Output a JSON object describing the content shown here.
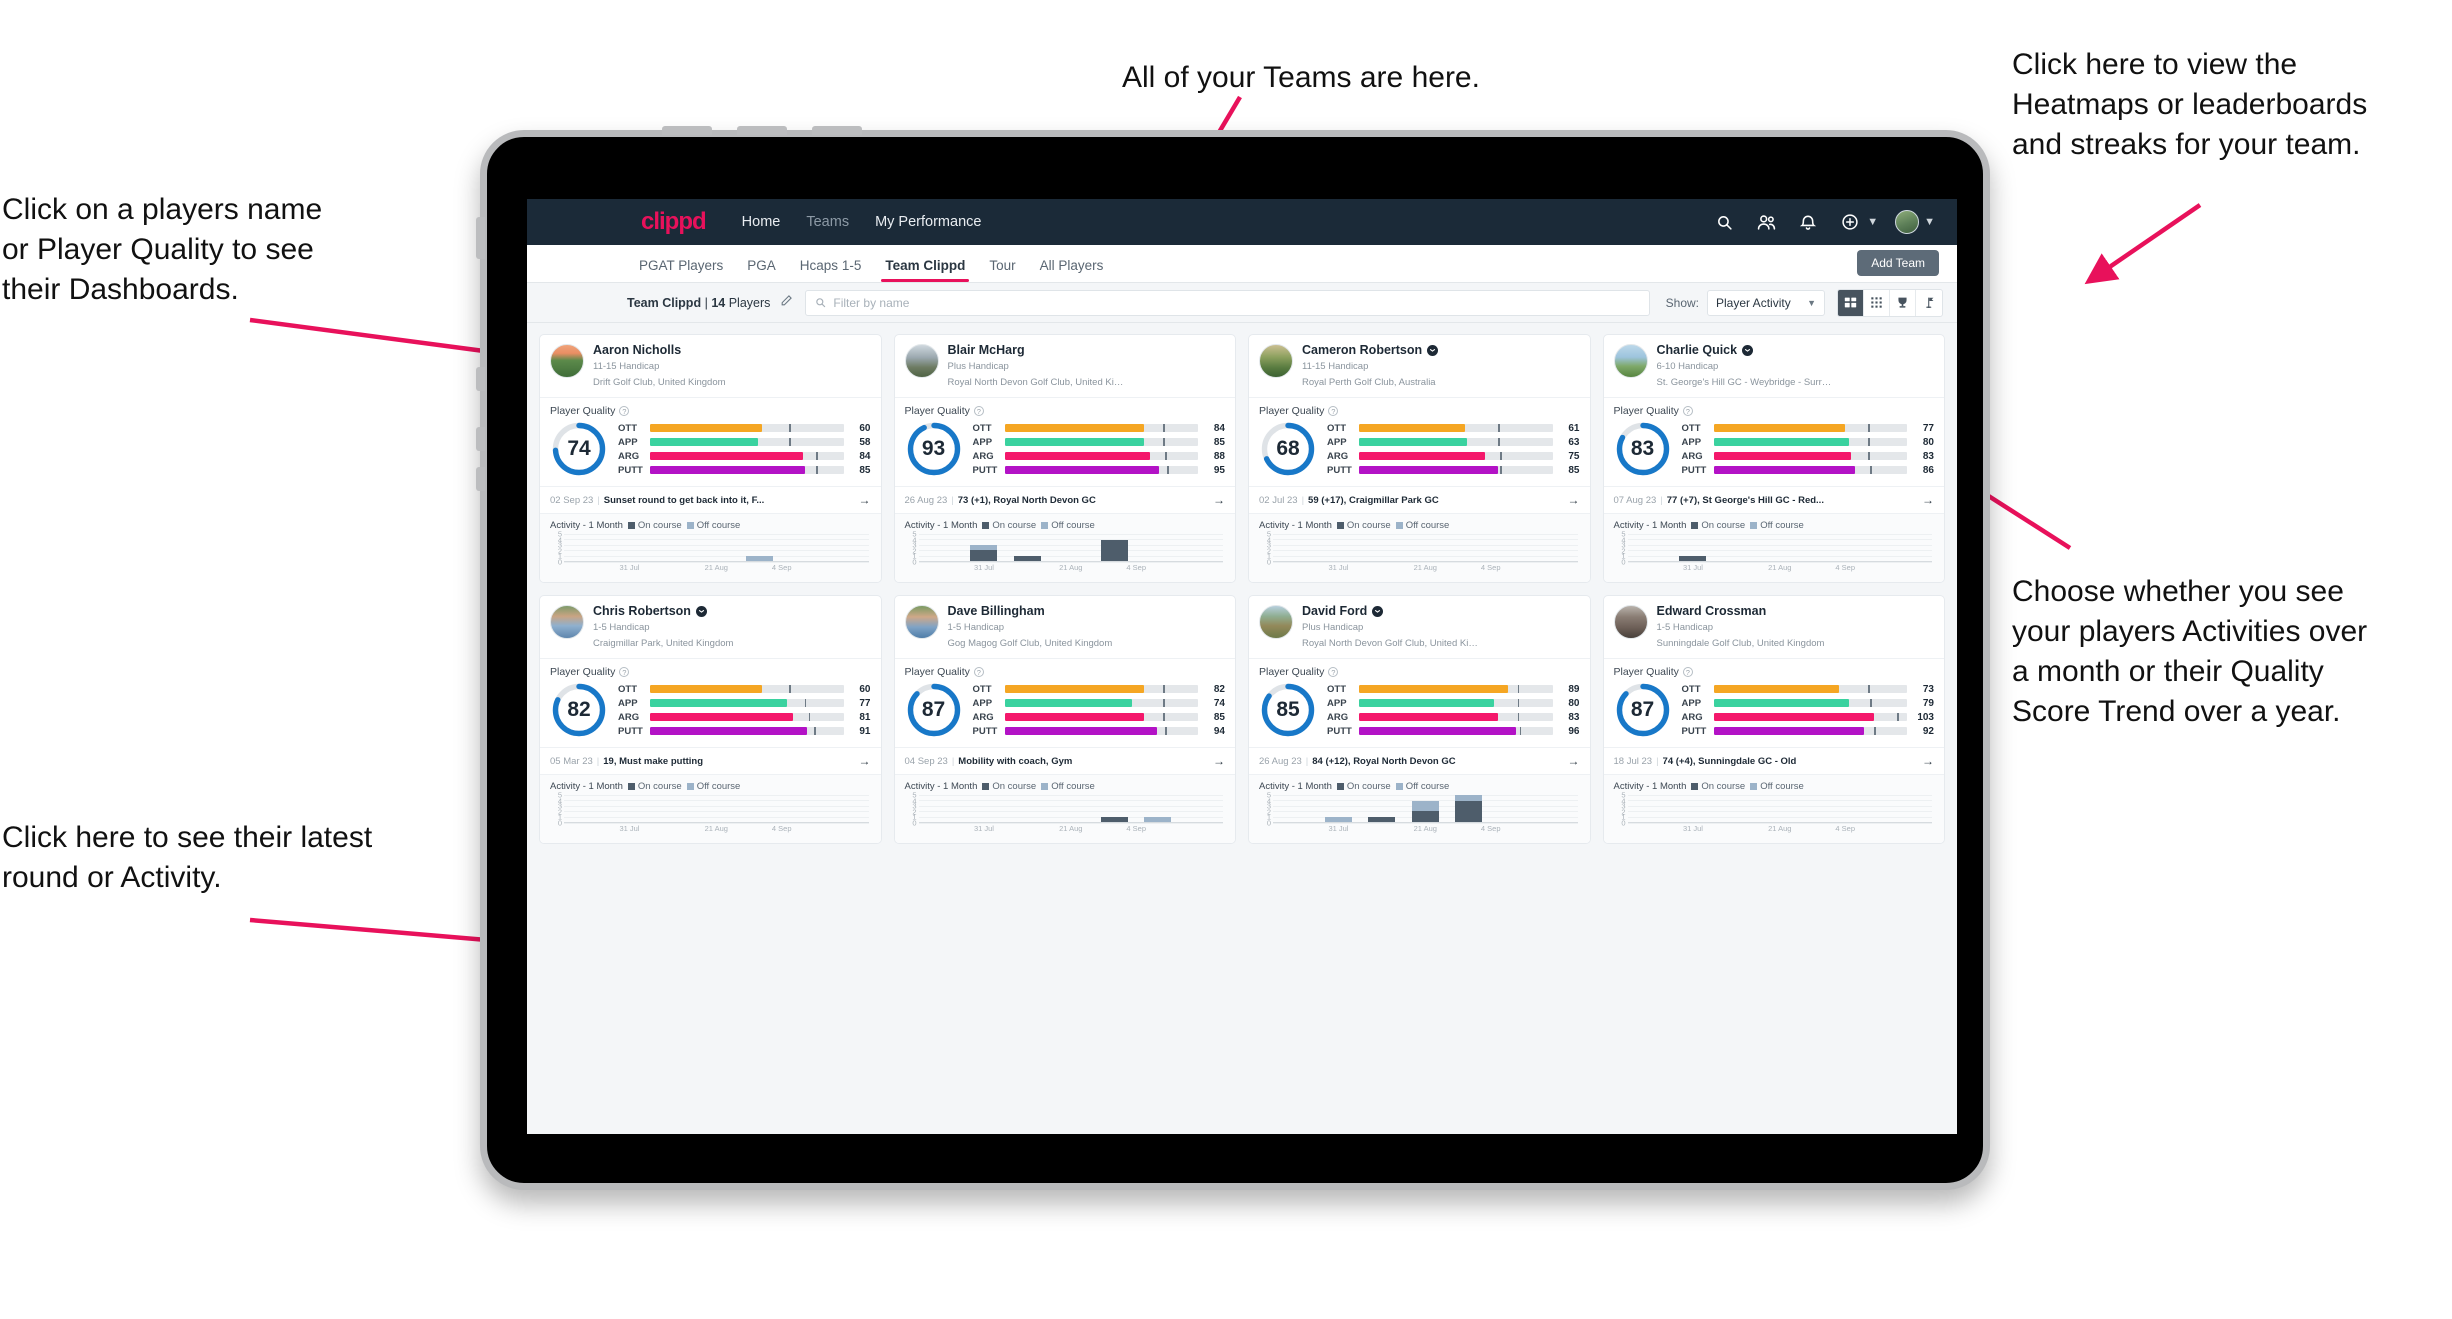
{
  "annotations": {
    "teams": "All of your Teams are here.",
    "heatmaps": "Click here to view the\nHeatmaps or leaderboards\nand streaks for your team.",
    "players": "Click on a players name\nor Player Quality to see\ntheir Dashboards.",
    "choose": "Choose whether you see\nyour players Activities over\na month or their Quality\nScore Trend over a year.",
    "latest": "Click here to see their latest\nround or Activity.",
    "arrow_color": "#e8115b"
  },
  "app": {
    "brand": "clippd",
    "nav_links": [
      {
        "label": "Home",
        "active": true
      },
      {
        "label": "Teams",
        "active": false
      },
      {
        "label": "My Performance",
        "active": true
      }
    ],
    "nav_icons": [
      "search-icon",
      "people-icon",
      "bell-icon",
      "plus-circle-icon",
      "avatar"
    ],
    "tabs": [
      {
        "label": "PGAT Players",
        "active": false
      },
      {
        "label": "PGA",
        "active": false
      },
      {
        "label": "Hcaps 1-5",
        "active": false
      },
      {
        "label": "Team Clippd",
        "active": true
      },
      {
        "label": "Tour",
        "active": false
      },
      {
        "label": "All Players",
        "active": false
      }
    ],
    "add_team_label": "Add Team",
    "filter": {
      "team_name": "Team Clippd",
      "divider": "|",
      "player_count": "14",
      "players_word": "Players",
      "edit_icon": "pencil-icon",
      "search_placeholder": "Filter by name",
      "show_label": "Show:",
      "show_value": "Player Activity",
      "view_buttons": [
        {
          "name": "cards-view",
          "icon": "grid-cards-icon",
          "active": true
        },
        {
          "name": "compact-view",
          "icon": "grid-dots-icon",
          "active": false
        },
        {
          "name": "leaderboard-view",
          "icon": "trophy-icon",
          "active": false
        },
        {
          "name": "heatmap-view",
          "icon": "golf-flag-icon",
          "active": false
        }
      ]
    },
    "card_labels": {
      "quality_title": "Player Quality",
      "help_glyph": "?",
      "activity_title": "Activity - 1 Month",
      "legend_on": "On course",
      "legend_off": "Off course",
      "arrow_glyph": "→"
    },
    "metric_colors": {
      "OTT": "#f5a623",
      "APP": "#3ad29f",
      "ARG": "#f4186b",
      "PUTT": "#b312c6",
      "ring": "#1878c8",
      "ring_track": "#dfe3e7"
    },
    "chart_axis": {
      "y_ticks": [
        "5",
        "4",
        "3",
        "2",
        "1",
        "0"
      ],
      "y_max": 5,
      "x_ticks": [
        "31 Jul",
        "21 Aug",
        "4 Sep"
      ],
      "slots": 7
    }
  },
  "players": [
    {
      "name": "Aaron Nicholls",
      "verified": false,
      "handicap": "11-15 Handicap",
      "club": "Drift Golf Club, United Kingdom",
      "quality": "74",
      "metrics": [
        {
          "label": "OTT",
          "value": "60",
          "fill": 58,
          "tick": 72
        },
        {
          "label": "APP",
          "value": "58",
          "fill": 56,
          "tick": 72
        },
        {
          "label": "ARG",
          "value": "84",
          "fill": 79,
          "tick": 86
        },
        {
          "label": "PUTT",
          "value": "85",
          "fill": 80,
          "tick": 86
        }
      ],
      "round_date": "02 Sep 23",
      "round_text": "Sunset round to get back into it, F...",
      "activity": [
        {
          "on": 0,
          "off": 0
        },
        {
          "on": 0,
          "off": 0
        },
        {
          "on": 0,
          "off": 0
        },
        {
          "on": 0,
          "off": 0
        },
        {
          "on": 0,
          "off": 1
        },
        {
          "on": 0,
          "off": 0
        },
        {
          "on": 0,
          "off": 0
        }
      ],
      "avatar_style": "photo-sunset-fairway"
    },
    {
      "name": "Blair McHarg",
      "verified": false,
      "handicap": "Plus Handicap",
      "club": "Royal North Devon Golf Club, United Kin...",
      "quality": "93",
      "metrics": [
        {
          "label": "OTT",
          "value": "84",
          "fill": 72,
          "tick": 82
        },
        {
          "label": "APP",
          "value": "85",
          "fill": 72,
          "tick": 82
        },
        {
          "label": "ARG",
          "value": "88",
          "fill": 75,
          "tick": 83
        },
        {
          "label": "PUTT",
          "value": "95",
          "fill": 80,
          "tick": 84
        }
      ],
      "round_date": "26 Aug 23",
      "round_text": "73 (+1), Royal North Devon GC",
      "activity": [
        {
          "on": 0,
          "off": 0
        },
        {
          "on": 2,
          "off": 1
        },
        {
          "on": 1,
          "off": 0
        },
        {
          "on": 0,
          "off": 0
        },
        {
          "on": 4,
          "off": 0
        },
        {
          "on": 0,
          "off": 0
        },
        {
          "on": 0,
          "off": 0
        }
      ],
      "avatar_style": "photo-links-dunes"
    },
    {
      "name": "Cameron Robertson",
      "verified": true,
      "handicap": "11-15 Handicap",
      "club": "Royal Perth Golf Club, Australia",
      "quality": "68",
      "metrics": [
        {
          "label": "OTT",
          "value": "61",
          "fill": 55,
          "tick": 72
        },
        {
          "label": "APP",
          "value": "63",
          "fill": 56,
          "tick": 72
        },
        {
          "label": "ARG",
          "value": "75",
          "fill": 65,
          "tick": 73
        },
        {
          "label": "PUTT",
          "value": "85",
          "fill": 72,
          "tick": 73
        }
      ],
      "round_date": "02 Jul 23",
      "round_text": "59 (+17), Craigmillar Park GC",
      "activity": [
        {
          "on": 0,
          "off": 0
        },
        {
          "on": 0,
          "off": 0
        },
        {
          "on": 0,
          "off": 0
        },
        {
          "on": 0,
          "off": 0
        },
        {
          "on": 0,
          "off": 0
        },
        {
          "on": 0,
          "off": 0
        },
        {
          "on": 0,
          "off": 0
        }
      ],
      "avatar_style": "photo-tree-green"
    },
    {
      "name": "Charlie Quick",
      "verified": true,
      "handicap": "6-10 Handicap",
      "club": "St. George's Hill GC - Weybridge - Surrey, ...",
      "quality": "83",
      "metrics": [
        {
          "label": "OTT",
          "value": "77",
          "fill": 68,
          "tick": 80
        },
        {
          "label": "APP",
          "value": "80",
          "fill": 70,
          "tick": 80
        },
        {
          "label": "ARG",
          "value": "83",
          "fill": 71,
          "tick": 80
        },
        {
          "label": "PUTT",
          "value": "86",
          "fill": 73,
          "tick": 81
        }
      ],
      "round_date": "07 Aug 23",
      "round_text": "77 (+7), St George's Hill GC - Red...",
      "activity": [
        {
          "on": 0,
          "off": 0
        },
        {
          "on": 1,
          "off": 0
        },
        {
          "on": 0,
          "off": 0
        },
        {
          "on": 0,
          "off": 0
        },
        {
          "on": 0,
          "off": 0
        },
        {
          "on": 0,
          "off": 0
        },
        {
          "on": 0,
          "off": 0
        }
      ],
      "avatar_style": "photo-sky-green"
    },
    {
      "name": "Chris Robertson",
      "verified": true,
      "handicap": "1-5 Handicap",
      "club": "Craigmillar Park, United Kingdom",
      "quality": "82",
      "metrics": [
        {
          "label": "OTT",
          "value": "60",
          "fill": 58,
          "tick": 72
        },
        {
          "label": "APP",
          "value": "77",
          "fill": 71,
          "tick": 80
        },
        {
          "label": "ARG",
          "value": "81",
          "fill": 74,
          "tick": 82
        },
        {
          "label": "PUTT",
          "value": "91",
          "fill": 81,
          "tick": 85
        }
      ],
      "round_date": "05 Mar 23",
      "round_text": "19, Must make putting",
      "activity": [
        {
          "on": 0,
          "off": 0
        },
        {
          "on": 0,
          "off": 0
        },
        {
          "on": 0,
          "off": 0
        },
        {
          "on": 0,
          "off": 0
        },
        {
          "on": 0,
          "off": 0
        },
        {
          "on": 0,
          "off": 0
        },
        {
          "on": 0,
          "off": 0
        }
      ],
      "avatar_style": "photo-man-blue-shirt"
    },
    {
      "name": "Dave Billingham",
      "verified": false,
      "handicap": "1-5 Handicap",
      "club": "Gog Magog Golf Club, United Kingdom",
      "quality": "87",
      "metrics": [
        {
          "label": "OTT",
          "value": "82",
          "fill": 72,
          "tick": 82
        },
        {
          "label": "APP",
          "value": "74",
          "fill": 66,
          "tick": 82
        },
        {
          "label": "ARG",
          "value": "85",
          "fill": 72,
          "tick": 82
        },
        {
          "label": "PUTT",
          "value": "94",
          "fill": 79,
          "tick": 83
        }
      ],
      "round_date": "04 Sep 23",
      "round_text": "Mobility with coach, Gym",
      "activity": [
        {
          "on": 0,
          "off": 0
        },
        {
          "on": 0,
          "off": 0
        },
        {
          "on": 0,
          "off": 0
        },
        {
          "on": 0,
          "off": 0
        },
        {
          "on": 1,
          "off": 0
        },
        {
          "on": 0,
          "off": 1
        },
        {
          "on": 0,
          "off": 0
        }
      ],
      "avatar_style": "photo-man-beard"
    },
    {
      "name": "David Ford",
      "verified": true,
      "handicap": "Plus Handicap",
      "club": "Royal North Devon Golf Club, United Kin...",
      "quality": "85",
      "metrics": [
        {
          "label": "OTT",
          "value": "89",
          "fill": 77,
          "tick": 82
        },
        {
          "label": "APP",
          "value": "80",
          "fill": 70,
          "tick": 82
        },
        {
          "label": "ARG",
          "value": "83",
          "fill": 72,
          "tick": 82
        },
        {
          "label": "PUTT",
          "value": "96",
          "fill": 81,
          "tick": 83
        }
      ],
      "round_date": "26 Aug 23",
      "round_text": "84 (+12), Royal North Devon GC",
      "activity": [
        {
          "on": 0,
          "off": 0
        },
        {
          "on": 0,
          "off": 1
        },
        {
          "on": 1,
          "off": 0
        },
        {
          "on": 2,
          "off": 2
        },
        {
          "on": 4,
          "off": 1
        },
        {
          "on": 0,
          "off": 0
        },
        {
          "on": 0,
          "off": 0
        }
      ],
      "avatar_style": "photo-hill-walk"
    },
    {
      "name": "Edward Crossman",
      "verified": false,
      "handicap": "1-5 Handicap",
      "club": "Sunningdale Golf Club, United Kingdom",
      "quality": "87",
      "metrics": [
        {
          "label": "OTT",
          "value": "73",
          "fill": 65,
          "tick": 80
        },
        {
          "label": "APP",
          "value": "79",
          "fill": 70,
          "tick": 81
        },
        {
          "label": "ARG",
          "value": "103",
          "fill": 83,
          "tick": 95
        },
        {
          "label": "PUTT",
          "value": "92",
          "fill": 78,
          "tick": 83
        }
      ],
      "round_date": "18 Jul 23",
      "round_text": "74 (+4), Sunningdale GC - Old",
      "activity": [
        {
          "on": 0,
          "off": 0
        },
        {
          "on": 0,
          "off": 0
        },
        {
          "on": 0,
          "off": 0
        },
        {
          "on": 0,
          "off": 0
        },
        {
          "on": 0,
          "off": 0
        },
        {
          "on": 0,
          "off": 0
        },
        {
          "on": 0,
          "off": 0
        }
      ],
      "avatar_style": "photo-indoor"
    }
  ]
}
